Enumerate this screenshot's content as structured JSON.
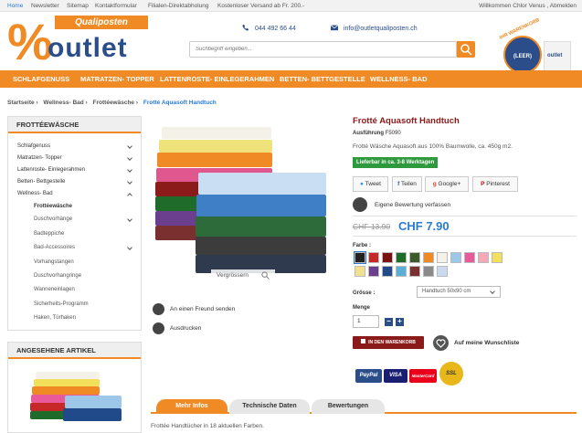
{
  "topbar": {
    "links": [
      "Home",
      "Newsletter",
      "Sitemap",
      "Kontaktformular",
      "Filialen-Direktabholung",
      "Kostenloser Versand ab Fr. 200.-"
    ],
    "welcome": "Willkommen Chlor Venus , Abmelden"
  },
  "header": {
    "logo_banner": "Qualiposten",
    "logo_pct": "%",
    "logo_word": "outlet",
    "phone": "044 492 66 44",
    "email": "info@outletqualiposten.ch",
    "search_placeholder": "Suchbegriff eingeben...",
    "cart_arc": "IHR WARENKORB",
    "cart_label": "(LEER)",
    "cart_bag_text": "outlet"
  },
  "nav": [
    "SCHLAFGENUSS",
    "MATRATZEN- TOPPER",
    "LATTENROSTE- EINLEGERAHMEN",
    "BETTEN- BETTGESTELLE",
    "WELLNESS- BAD"
  ],
  "breadcrumb": [
    "Startseite",
    "Wellness- Bad",
    "Frottéewäsche",
    "Frotté Aquasoft Handtuch"
  ],
  "breadcrumb_sep": "›",
  "sidebar": {
    "heading": "FROTTÉEWÄSCHE",
    "categories": [
      "Schlafgenuss",
      "Matratzen- Topper",
      "Lattenroste- Einlegerahmen",
      "Betten- Bettgestelle",
      "Wellness- Bad"
    ],
    "subcategories": [
      "Frottéewäsche",
      "Duschvorhänge",
      "Badteppiche",
      "Bad-Accessoires",
      "Vorhangstangen",
      "Duschvorhangringe",
      "Wanneneinlagen",
      "Sicherheits-Programm",
      "Haken, Türhaken"
    ],
    "recent_heading": "ANGESEHENE ARTIKEL"
  },
  "gallery": {
    "zoom_label": "Vergrössern",
    "send_friend": "An einen Freund senden",
    "print": "Ausdrucken"
  },
  "product": {
    "title": "Frotté Aquasoft Handtuch",
    "ausfuehrung_label": "Ausführung",
    "ausfuehrung_value": "F5090",
    "description": "Frotté Wäsche Aquasoft aus 100% Baumwolle, ca. 450g m2.",
    "delivery": "Lieferbar in ca. 3-8 Werktagen",
    "share": [
      "Tweet",
      "Teilen",
      "Google+",
      "Pinterest"
    ],
    "review": "Eigene Bewertung verfassen",
    "old_price": "CHF 13.90",
    "new_price": "CHF 7.90",
    "farbe_label": "Farbe :",
    "colors": [
      "#222222",
      "#c62828",
      "#7a1010",
      "#1e6b2a",
      "#3c5a2a",
      "#f08a24",
      "#f4f1e8",
      "#9dc7e8",
      "#e85a9a",
      "#f3a9b6",
      "#f2df5a",
      "#f1e08e",
      "#6b3f8e",
      "#214a8a",
      "#5aaed8",
      "#7b3030",
      "#8a8a8a",
      "#c9d9f0"
    ],
    "groesse_label": "Grösse :",
    "size_value": "Handtuch 50x90 cm",
    "menge_label": "Menge",
    "qty": "1",
    "minus": "−",
    "plus": "+",
    "add_to_cart": "IN DEN WARENKORB",
    "wishlist": "Auf meine Wunschliste",
    "payments": [
      "PayPal",
      "VISA",
      "MasterCard",
      "SSL"
    ]
  },
  "tabs": [
    "Mehr Infos",
    "Technische Daten",
    "Bewertungen"
  ],
  "tab_text": "Frottée Handtücher in 18 aktuellen Farben."
}
